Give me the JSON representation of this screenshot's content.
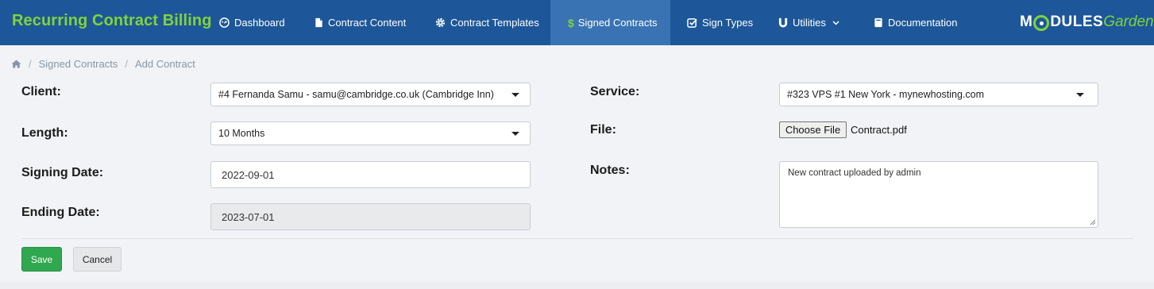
{
  "app": {
    "title": "Recurring Contract Billing",
    "accent_color": "#7fd33a",
    "nav_color": "#1e5799",
    "active_nav_color": "#3a73b3"
  },
  "nav": {
    "items": [
      {
        "label": "Dashboard",
        "icon": "dashboard-icon"
      },
      {
        "label": "Contract Content",
        "icon": "file-icon"
      },
      {
        "label": "Contract Templates",
        "icon": "gear-icon"
      },
      {
        "label": "Signed Contracts",
        "icon": "dollar-icon",
        "active": true
      },
      {
        "label": "Sign Types",
        "icon": "checkbox-icon"
      },
      {
        "label": "Utilities",
        "icon": "magnet-icon",
        "dropdown": true
      },
      {
        "label": "Documentation",
        "icon": "book-icon"
      }
    ],
    "logo": {
      "bold": "M",
      "bold_rest": "DULES",
      "light": "Garden"
    }
  },
  "breadcrumb": {
    "home_icon": "home-icon",
    "items": [
      "Signed Contracts",
      "Add Contract"
    ]
  },
  "form": {
    "client": {
      "label": "Client:",
      "value": "#4 Fernanda Samu - samu@cambridge.co.uk (Cambridge Inn)"
    },
    "length": {
      "label": "Length:",
      "value": "10 Months"
    },
    "signing_date": {
      "label": "Signing Date:",
      "value": "2022-09-01"
    },
    "ending_date": {
      "label": "Ending Date:",
      "value": "2023-07-01"
    },
    "service": {
      "label": "Service:",
      "value": "#323 VPS #1 New York - mynewhosting.com"
    },
    "file": {
      "label": "File:",
      "button": "Choose File",
      "filename": "Contract.pdf"
    },
    "notes": {
      "label": "Notes:",
      "value": "New contract uploaded by admin"
    }
  },
  "actions": {
    "save": "Save",
    "cancel": "Cancel",
    "save_color": "#2fa84f"
  }
}
